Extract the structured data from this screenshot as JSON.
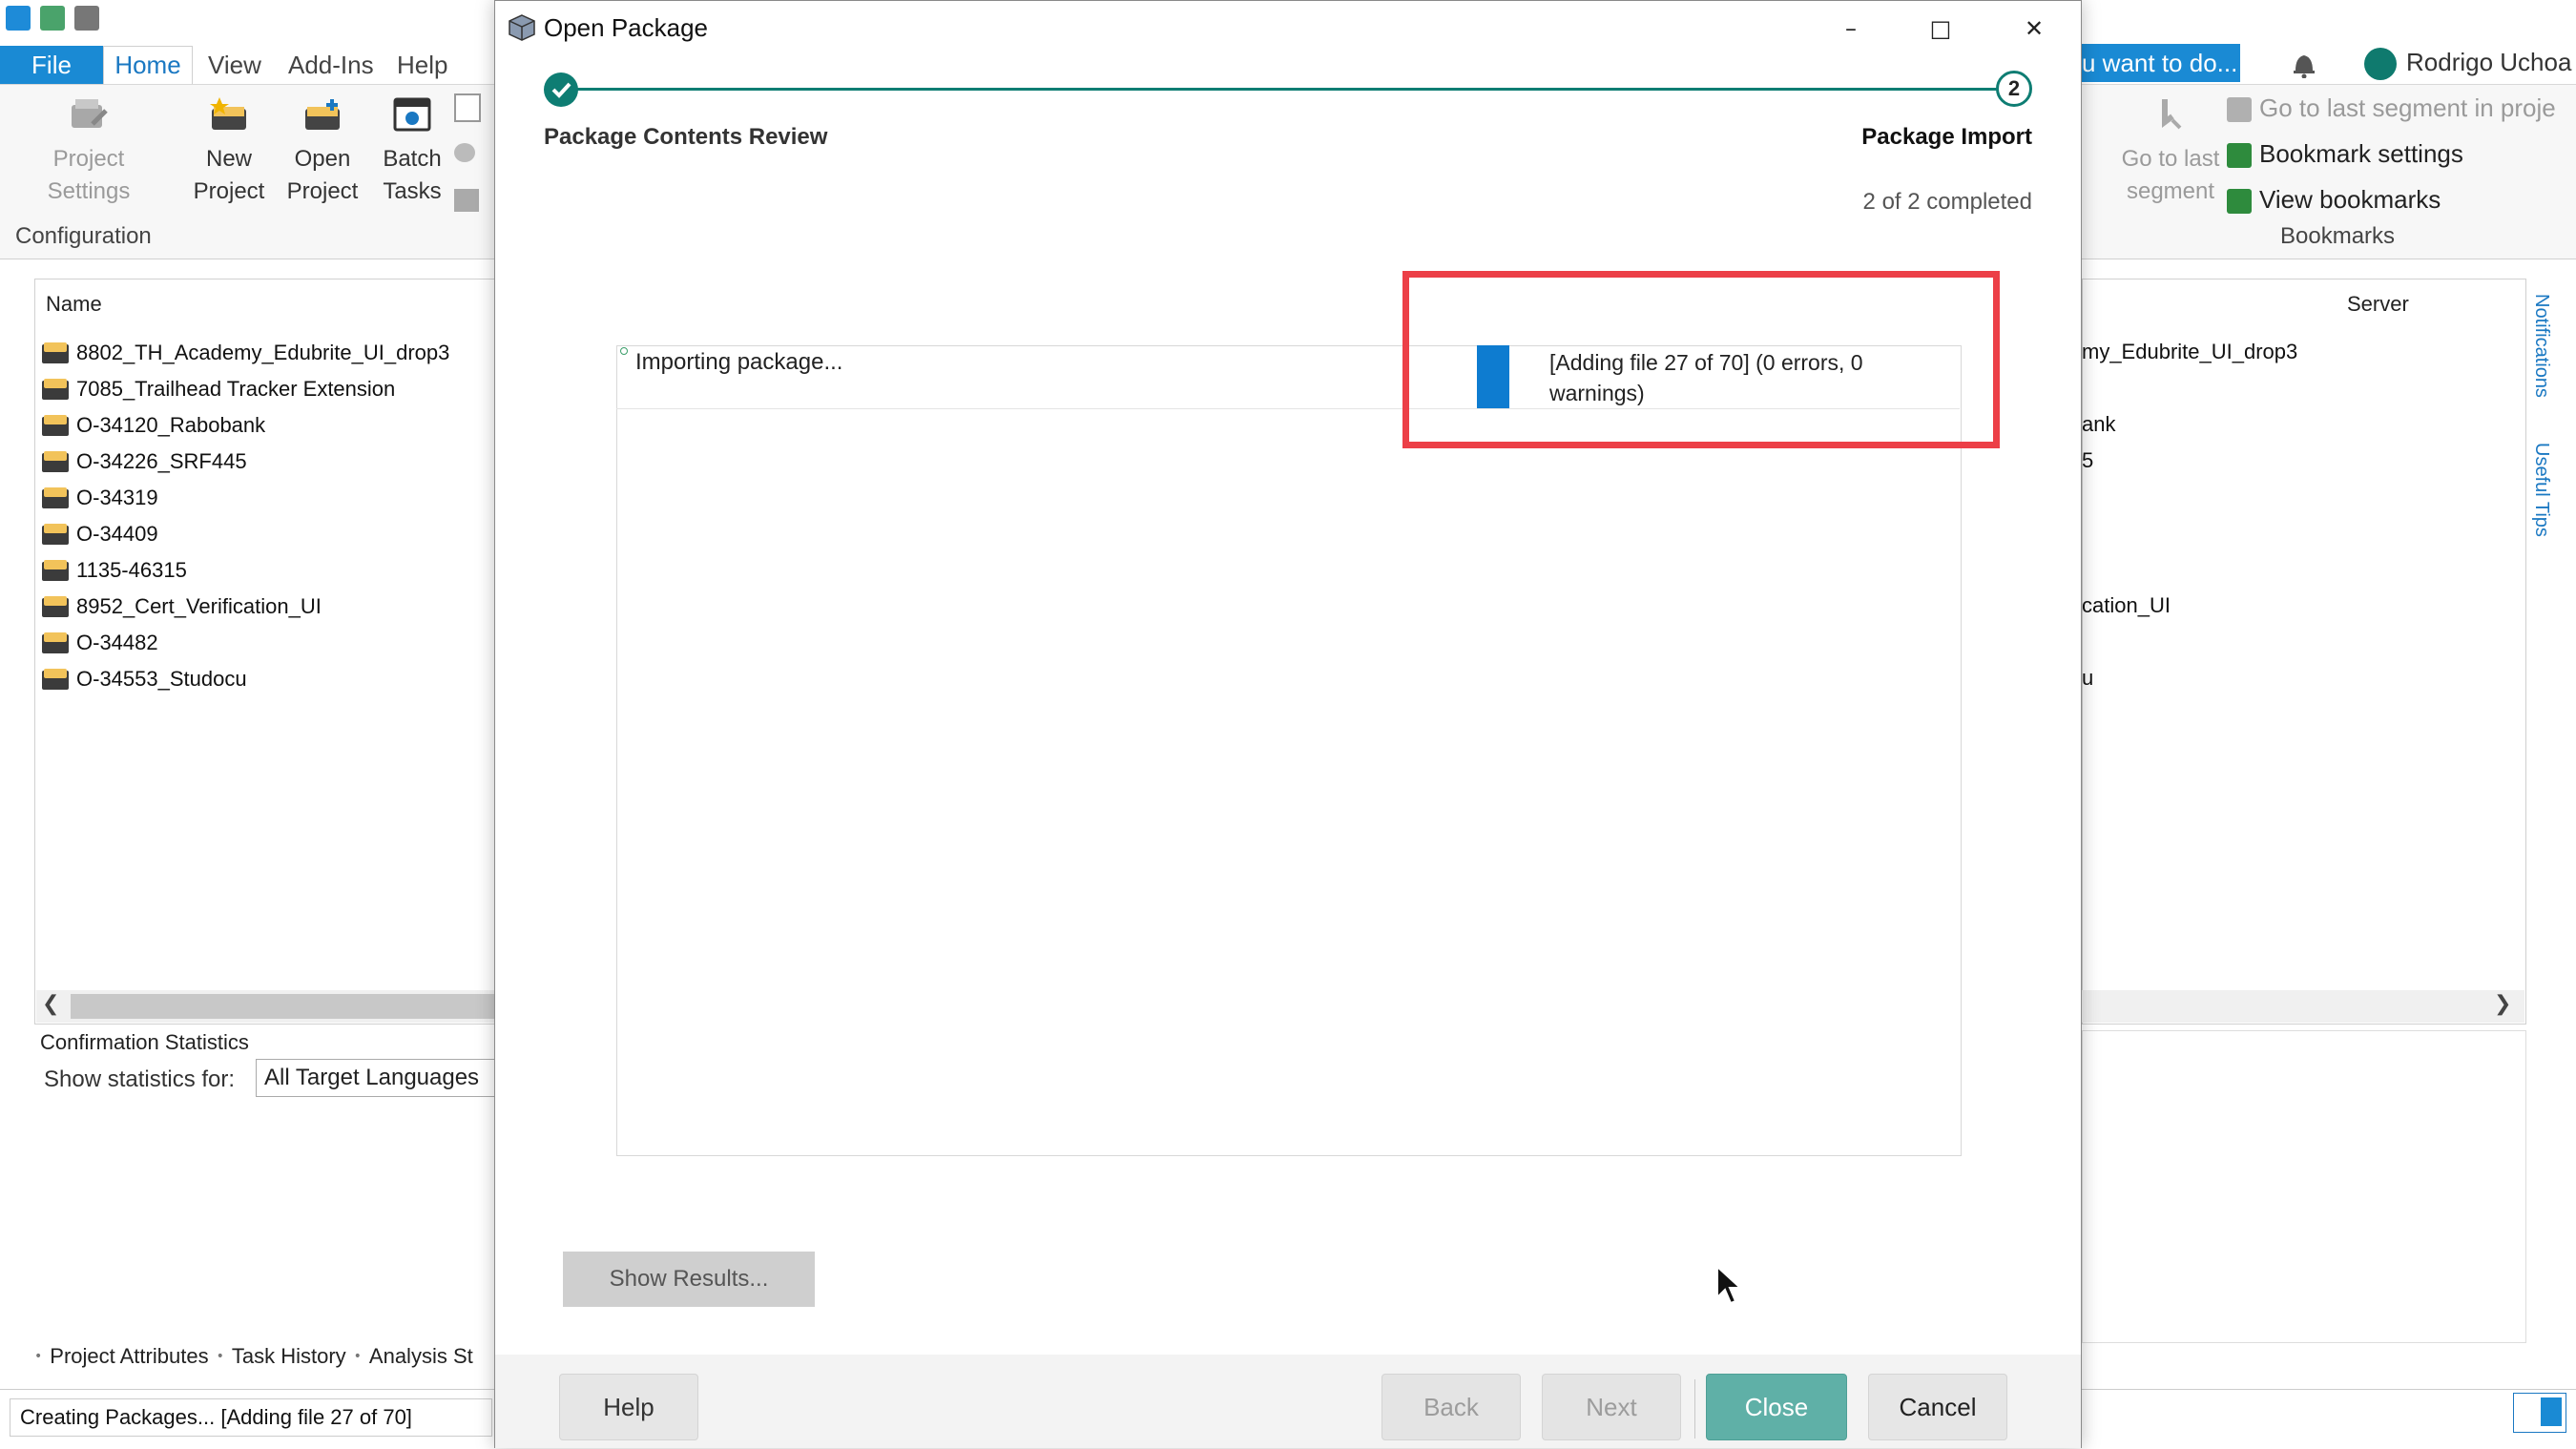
{
  "menubar": {
    "file": "File",
    "home": "Home",
    "view": "View",
    "addins": "Add-Ins",
    "help": "Help"
  },
  "ribbon": {
    "project_settings": [
      "Project",
      "Settings"
    ],
    "new_project": [
      "New",
      "Project"
    ],
    "open_project": [
      "Open",
      "Project"
    ],
    "batch_tasks": [
      "Batch",
      "Tasks"
    ],
    "group_configuration": "Configuration",
    "go_to_last_segment": [
      "Go to last",
      "segment"
    ],
    "go_to_last_in_project": "Go to last segment in proje",
    "bookmark_settings": "Bookmark settings",
    "view_bookmarks": "View bookmarks",
    "group_bookmarks": "Bookmarks"
  },
  "search": {
    "text": "u want to do..."
  },
  "user": {
    "name": "Rodrigo Uchoa",
    "avatar_color": "#0f7a6e"
  },
  "projects": {
    "column_name": "Name",
    "column_server": "Server",
    "rows": [
      "8802_TH_Academy_Edubrite_UI_drop3",
      "7085_Trailhead Tracker Extension",
      "O-34120_Rabobank",
      "O-34226_SRF445",
      "O-34319",
      "O-34409",
      "1135-46315",
      "8952_Cert_Verification_UI",
      "O-34482",
      "O-34553_Studocu"
    ],
    "right_fragments": [
      "my_Edubrite_UI_drop3",
      "ank",
      "5",
      "cation_UI",
      "u"
    ]
  },
  "stats": {
    "title": "Confirmation Statistics",
    "label": "Show statistics for:",
    "selected": "All Target Languages"
  },
  "bottom_tabs": [
    "Project Attributes",
    "Task History",
    "Analysis St"
  ],
  "status_bar": {
    "text": "Creating Packages... [Adding file 27 of 70]"
  },
  "side_tabs": [
    "Notifications",
    "Useful Tips"
  ],
  "dialog": {
    "title": "Open Package",
    "step1_label": "Package Contents Review",
    "step2_number": "2",
    "step2_label": "Package Import",
    "completed": "2 of 2 completed",
    "log_task": "Importing package...",
    "log_status": "[Adding file 27 of 70] (0 errors, 0 warnings)",
    "show_results": "Show Results...",
    "buttons": {
      "help": "Help",
      "back": "Back",
      "next": "Next",
      "close": "Close",
      "cancel": "Cancel"
    }
  },
  "colors": {
    "accent_blue": "#1a8ad4",
    "step_teal": "#0e7d73",
    "close_button": "#5fb0a7",
    "highlight_red": "#ec3f47",
    "progress_blue": "#0e7cd0"
  }
}
